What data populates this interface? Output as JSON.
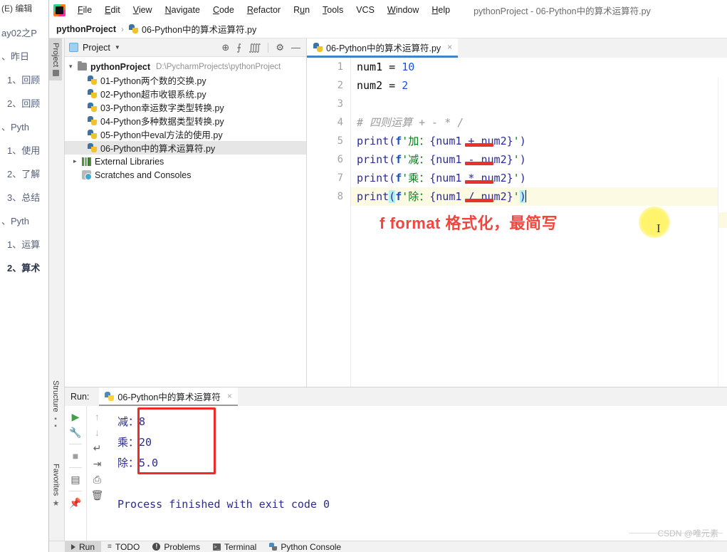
{
  "background_window": {
    "top_label": "(E)  编辑",
    "items": [
      "ay02之P",
      "、昨日",
      "1、回顾",
      "2、回顾",
      "、Pyth",
      "1、使用",
      "2、了解",
      "3、总结",
      "、Pyth",
      "1、运算",
      "2、算术"
    ]
  },
  "window": {
    "title": "pythonProject - 06-Python中的算术运算符.py",
    "app_icon": "pycharm-logo-icon"
  },
  "menubar": {
    "items": [
      {
        "label": "File",
        "mnemonic": "F"
      },
      {
        "label": "Edit",
        "mnemonic": "E"
      },
      {
        "label": "View",
        "mnemonic": "V"
      },
      {
        "label": "Navigate",
        "mnemonic": "N"
      },
      {
        "label": "Code",
        "mnemonic": "C"
      },
      {
        "label": "Refactor",
        "mnemonic": "R"
      },
      {
        "label": "Run",
        "mnemonic": "u"
      },
      {
        "label": "Tools",
        "mnemonic": "T"
      },
      {
        "label": "VCS",
        "mnemonic": ""
      },
      {
        "label": "Window",
        "mnemonic": "W"
      },
      {
        "label": "Help",
        "mnemonic": "H"
      }
    ]
  },
  "breadcrumb": {
    "project": "pythonProject",
    "separator": "›",
    "file": "06-Python中的算术运算符.py"
  },
  "tool_tabs": {
    "project": "Project",
    "structure": "Structure",
    "favorites": "Favorites"
  },
  "project_panel": {
    "header_label": "Project",
    "tools": [
      {
        "name": "locate-target-icon",
        "glyph": "⊕"
      },
      {
        "name": "expand-all-icon",
        "glyph": "⨍"
      },
      {
        "name": "collapse-all-icon",
        "glyph": "⨌"
      },
      {
        "name": "settings-gear-icon",
        "glyph": "⚙"
      },
      {
        "name": "hide-panel-icon",
        "glyph": "—"
      }
    ],
    "root": {
      "name": "pythonProject",
      "path": "D:\\PycharmProjects\\pythonProject"
    },
    "files": [
      "01-Python两个数的交换.py",
      "02-Python超市收银系统.py",
      "03-Python幸运数字类型转换.py",
      "04-Python多种数据类型转换.py",
      "05-Python中eval方法的使用.py",
      "06-Python中的算术运算符.py"
    ],
    "selected_file": "06-Python中的算术运算符.py",
    "external_libraries": "External Libraries",
    "scratches": "Scratches and Consoles"
  },
  "editor": {
    "tab_label": "06-Python中的算术运算符.py",
    "tab_close": "×",
    "line_numbers": [
      "1",
      "2",
      "3",
      "4",
      "5",
      "6",
      "7",
      "8"
    ],
    "code_lines": [
      "num1 = 10",
      "num2 = 2",
      "",
      "# 四则运算 + - * /",
      "print(f'加：{num1 + num2}')",
      "print(f'减：{num1 - num2}')",
      "print(f'乘：{num1 * num2}')",
      "print(f'除：{num1 / num2}')"
    ],
    "current_line": 8,
    "annotation": "f format 格式化，最简写",
    "annotation_color": "#f2453d",
    "underline_color": "#e8332a",
    "underlined_operators": [
      "+",
      "-",
      "*",
      "/"
    ]
  },
  "run_panel": {
    "label": "Run:",
    "tab_label": "06-Python中的算术运算符",
    "tab_close": "×",
    "left_toolbar": [
      {
        "name": "rerun-icon",
        "glyph": "▶"
      },
      {
        "name": "wrench-settings-icon",
        "glyph": "🔧"
      },
      {
        "name": "stop-icon",
        "glyph": "■"
      },
      {
        "name": "layout-icon",
        "glyph": "▤"
      },
      {
        "name": "pin-icon",
        "glyph": "📌"
      }
    ],
    "second_toolbar": [
      {
        "name": "up-arrow-icon",
        "glyph": "↑"
      },
      {
        "name": "down-arrow-icon",
        "glyph": "↓"
      },
      {
        "name": "soft-wrap-icon",
        "glyph": "↵"
      },
      {
        "name": "scroll-to-end-icon",
        "glyph": "⇥"
      },
      {
        "name": "print-icon",
        "glyph": "⎙"
      },
      {
        "name": "clear-all-icon",
        "glyph": "🗑"
      }
    ],
    "output_lines": [
      "减：8",
      "乘：20",
      "除：5.0"
    ],
    "exit_message": "Process finished with exit code 0",
    "highlight_box_color": "#ef2a28"
  },
  "status_bar": {
    "items": [
      {
        "label": "Run",
        "icon": "run-triangle-icon",
        "selected": true
      },
      {
        "label": "TODO",
        "icon": "todo-list-icon",
        "selected": false
      },
      {
        "label": "Problems",
        "icon": "problems-warning-icon",
        "selected": false
      },
      {
        "label": "Terminal",
        "icon": "terminal-icon",
        "selected": false
      },
      {
        "label": "Python Console",
        "icon": "python-console-icon",
        "selected": false
      }
    ]
  },
  "watermark": "CSDN @唯元素"
}
